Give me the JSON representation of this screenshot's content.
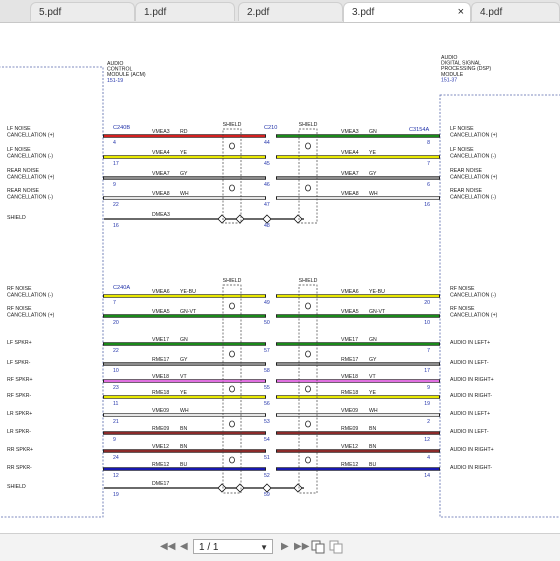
{
  "tabs": [
    {
      "label": "5.pdf",
      "active": false
    },
    {
      "label": "1.pdf",
      "active": false
    },
    {
      "label": "2.pdf",
      "active": false
    },
    {
      "label": "3.pdf",
      "active": true
    },
    {
      "label": "4.pdf",
      "active": false
    }
  ],
  "close_glyph": "×",
  "pager": {
    "value": "1 / 1",
    "first_glyph": "◀◀",
    "prev_glyph": "◀",
    "next_glyph": "▶",
    "last_glyph": "▶▶",
    "dropdown_glyph": "▼"
  },
  "diagram": {
    "left_module": [
      "AUDIO",
      "CONTROL",
      "MODULE (ACM)",
      "151-19"
    ],
    "right_module": [
      "AUDIO",
      "DIGITAL SIGNAL",
      "PROCESSING (DSP)",
      "MODULE",
      "151-37"
    ],
    "connectors": {
      "left_top": "C240B",
      "mid_top": "C210",
      "right_top": "C3154A",
      "left_bottom": "C240A"
    },
    "shield_label": "SHIELD",
    "top_group": [
      {
        "left_label": [
          "LF NOISE",
          "CANCELLATION (+)"
        ],
        "pin_l": "4",
        "circuit": "VMEA3",
        "color_code": "RD",
        "pin_m": "44",
        "circuit_r": "VMEA3",
        "color_code_r": "GN",
        "pin_r": "8",
        "right_label": [
          "LF NOISE",
          "CANCELLATION (+)"
        ],
        "color_l": "#d42020",
        "color_r": "#1a8a1a"
      },
      {
        "left_label": [
          "LF NOISE",
          "CANCELLATION (-)"
        ],
        "pin_l": "17",
        "circuit": "VMEA4",
        "color_code": "YE",
        "pin_m": "45",
        "circuit_r": "VMEA4",
        "color_code_r": "YE",
        "pin_r": "7",
        "right_label": [
          "LF NOISE",
          "CANCELLATION (-)"
        ],
        "color_l": "#e8e800",
        "color_r": "#e8e800"
      },
      {
        "left_label": [
          "REAR NOISE",
          "CANCELLATION (+)"
        ],
        "pin_l": "9",
        "circuit": "VMEA7",
        "color_code": "GY",
        "pin_m": "46",
        "circuit_r": "VMEA7",
        "color_code_r": "GY",
        "pin_r": "6",
        "right_label": [
          "REAR NOISE",
          "CANCELLATION (+)"
        ],
        "color_l": "#8c8c8c",
        "color_r": "#8c8c8c"
      },
      {
        "left_label": [
          "REAR NOISE",
          "CANCELLATION (-)"
        ],
        "pin_l": "22",
        "circuit": "VMEA8",
        "color_code": "WH",
        "pin_m": "47",
        "circuit_r": "VMEA8",
        "color_code_r": "WH",
        "pin_r": "16",
        "right_label": [
          "REAR NOISE",
          "CANCELLATION (-)"
        ],
        "color_l": "#e6e6e6",
        "color_r": "#e6e6e6"
      }
    ],
    "top_shield": {
      "left_label": "SHIELD",
      "pin_l": "16",
      "circuit": "DMEA3",
      "pin_m": "48"
    },
    "bottom_group": [
      {
        "left_label": [
          "RF NOISE",
          "CANCELLATION (-)"
        ],
        "pin_l": "7",
        "circuit": "VMEA6",
        "color_code": "YE-BU",
        "pin_m": "49",
        "circuit_r": "VMEA6",
        "color_code_r": "YE-BU",
        "pin_r": "20",
        "right_label": [
          "RF NOISE",
          "CANCELLATION (-)"
        ],
        "color_l": "#e8e800",
        "color_r": "#e8e800"
      },
      {
        "left_label": [
          "RF NOISE",
          "CANCELLATION (+)"
        ],
        "pin_l": "20",
        "circuit": "VMEA5",
        "color_code": "GN-VT",
        "pin_m": "50",
        "circuit_r": "VMEA5",
        "color_code_r": "GN-VT",
        "pin_r": "10",
        "right_label": [
          "RF NOISE",
          "CANCELLATION (+)"
        ],
        "color_l": "#1a8a1a",
        "color_r": "#1a8a1a"
      },
      {
        "left_label": [
          "LF SPKR+"
        ],
        "pin_l": "22",
        "circuit": "VME17",
        "color_code": "GN",
        "pin_m": "57",
        "circuit_r": "VME17",
        "color_code_r": "GN",
        "pin_r": "7",
        "right_label": [
          "AUDIO IN LEFT+"
        ],
        "color_l": "#1a8a1a",
        "color_r": "#1a8a1a"
      },
      {
        "left_label": [
          "LF SPKR-"
        ],
        "pin_l": "10",
        "circuit": "RME17",
        "color_code": "GY",
        "pin_m": "58",
        "circuit_r": "RME17",
        "color_code_r": "GY",
        "pin_r": "17",
        "right_label": [
          "AUDIO IN LEFT-"
        ],
        "color_l": "#8c8c8c",
        "color_r": "#8c8c8c"
      },
      {
        "left_label": [
          "RF SPKR+"
        ],
        "pin_l": "23",
        "circuit": "VME18",
        "color_code": "VT",
        "pin_m": "55",
        "circuit_r": "VME18",
        "color_code_r": "VT",
        "pin_r": "9",
        "right_label": [
          "AUDIO IN RIGHT+"
        ],
        "color_l": "#e070e0",
        "color_r": "#e070e0"
      },
      {
        "left_label": [
          "RF SPKR-"
        ],
        "pin_l": "11",
        "circuit": "RME18",
        "color_code": "YE",
        "pin_m": "56",
        "circuit_r": "RME18",
        "color_code_r": "YE",
        "pin_r": "19",
        "right_label": [
          "AUDIO IN RIGHT-"
        ],
        "color_l": "#e8e800",
        "color_r": "#e8e800"
      },
      {
        "left_label": [
          "LR SPKR+"
        ],
        "pin_l": "21",
        "circuit": "VME09",
        "color_code": "WH",
        "pin_m": "53",
        "circuit_r": "VME09",
        "color_code_r": "WH",
        "pin_r": "2",
        "right_label": [
          "AUDIO IN LEFT+"
        ],
        "color_l": "#e6e6e6",
        "color_r": "#e6e6e6"
      },
      {
        "left_label": [
          "LR SPKR-"
        ],
        "pin_l": "9",
        "circuit": "RME09",
        "color_code": "BN",
        "pin_m": "54",
        "circuit_r": "RME09",
        "color_code_r": "BN",
        "pin_r": "12",
        "right_label": [
          "AUDIO IN LEFT-"
        ],
        "color_l": "#8b2a2a",
        "color_r": "#8b2a2a"
      },
      {
        "left_label": [
          "RR SPKR+"
        ],
        "pin_l": "24",
        "circuit": "VME12",
        "color_code": "BN",
        "pin_m": "51",
        "circuit_r": "VME12",
        "color_code_r": "BN",
        "pin_r": "4",
        "right_label": [
          "AUDIO IN RIGHT+"
        ],
        "color_l": "#8b2a2a",
        "color_r": "#8b2a2a"
      },
      {
        "left_label": [
          "RR SPKR-"
        ],
        "pin_l": "12",
        "circuit": "RME12",
        "color_code": "BU",
        "pin_m": "52",
        "circuit_r": "RME12",
        "color_code_r": "BU",
        "pin_r": "14",
        "right_label": [
          "AUDIO IN RIGHT-"
        ],
        "color_l": "#1818b0",
        "color_r": "#1818b0"
      }
    ],
    "bottom_shield": {
      "left_label": "SHIELD",
      "pin_l": "19",
      "circuit": "DME17",
      "pin_m": "59"
    }
  }
}
